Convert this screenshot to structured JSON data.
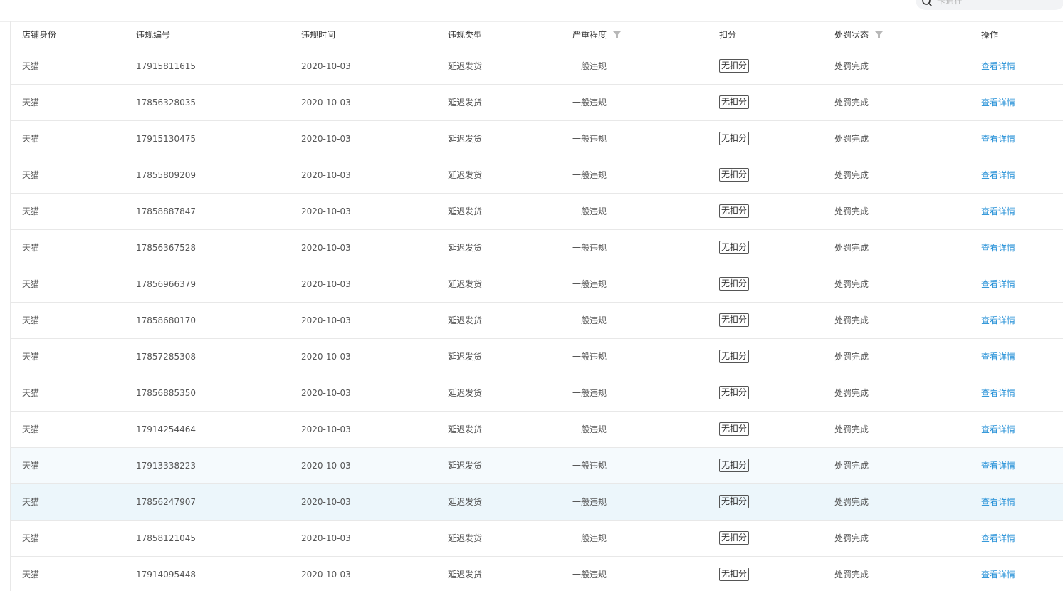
{
  "search": {
    "placeholder": "卡通在"
  },
  "table": {
    "columns": [
      {
        "label": "店铺身份",
        "filter": false
      },
      {
        "label": "违规编号",
        "filter": false
      },
      {
        "label": "违规时间",
        "filter": false
      },
      {
        "label": "违规类型",
        "filter": false
      },
      {
        "label": "严重程度",
        "filter": true
      },
      {
        "label": "扣分",
        "filter": false
      },
      {
        "label": "处罚状态",
        "filter": true
      },
      {
        "label": "操作",
        "filter": false
      }
    ],
    "rows": [
      {
        "shop": "天猫",
        "id": "17915811615",
        "date": "2020-10-03",
        "type": "延迟发货",
        "severity": "一般违规",
        "score": "无扣分",
        "status": "处罚完成",
        "action": "查看详情",
        "highlight": ""
      },
      {
        "shop": "天猫",
        "id": "17856328035",
        "date": "2020-10-03",
        "type": "延迟发货",
        "severity": "一般违规",
        "score": "无扣分",
        "status": "处罚完成",
        "action": "查看详情",
        "highlight": ""
      },
      {
        "shop": "天猫",
        "id": "17915130475",
        "date": "2020-10-03",
        "type": "延迟发货",
        "severity": "一般违规",
        "score": "无扣分",
        "status": "处罚完成",
        "action": "查看详情",
        "highlight": ""
      },
      {
        "shop": "天猫",
        "id": "17855809209",
        "date": "2020-10-03",
        "type": "延迟发货",
        "severity": "一般违规",
        "score": "无扣分",
        "status": "处罚完成",
        "action": "查看详情",
        "highlight": ""
      },
      {
        "shop": "天猫",
        "id": "17858887847",
        "date": "2020-10-03",
        "type": "延迟发货",
        "severity": "一般违规",
        "score": "无扣分",
        "status": "处罚完成",
        "action": "查看详情",
        "highlight": ""
      },
      {
        "shop": "天猫",
        "id": "17856367528",
        "date": "2020-10-03",
        "type": "延迟发货",
        "severity": "一般违规",
        "score": "无扣分",
        "status": "处罚完成",
        "action": "查看详情",
        "highlight": ""
      },
      {
        "shop": "天猫",
        "id": "17856966379",
        "date": "2020-10-03",
        "type": "延迟发货",
        "severity": "一般违规",
        "score": "无扣分",
        "status": "处罚完成",
        "action": "查看详情",
        "highlight": ""
      },
      {
        "shop": "天猫",
        "id": "17858680170",
        "date": "2020-10-03",
        "type": "延迟发货",
        "severity": "一般违规",
        "score": "无扣分",
        "status": "处罚完成",
        "action": "查看详情",
        "highlight": ""
      },
      {
        "shop": "天猫",
        "id": "17857285308",
        "date": "2020-10-03",
        "type": "延迟发货",
        "severity": "一般违规",
        "score": "无扣分",
        "status": "处罚完成",
        "action": "查看详情",
        "highlight": ""
      },
      {
        "shop": "天猫",
        "id": "17856885350",
        "date": "2020-10-03",
        "type": "延迟发货",
        "severity": "一般违规",
        "score": "无扣分",
        "status": "处罚完成",
        "action": "查看详情",
        "highlight": ""
      },
      {
        "shop": "天猫",
        "id": "17914254464",
        "date": "2020-10-03",
        "type": "延迟发货",
        "severity": "一般违规",
        "score": "无扣分",
        "status": "处罚完成",
        "action": "查看详情",
        "highlight": ""
      },
      {
        "shop": "天猫",
        "id": "17913338223",
        "date": "2020-10-03",
        "type": "延迟发货",
        "severity": "一般违规",
        "score": "无扣分",
        "status": "处罚完成",
        "action": "查看详情",
        "highlight": "light"
      },
      {
        "shop": "天猫",
        "id": "17856247907",
        "date": "2020-10-03",
        "type": "延迟发货",
        "severity": "一般违规",
        "score": "无扣分",
        "status": "处罚完成",
        "action": "查看详情",
        "highlight": "strong"
      },
      {
        "shop": "天猫",
        "id": "17858121045",
        "date": "2020-10-03",
        "type": "延迟发货",
        "severity": "一般违规",
        "score": "无扣分",
        "status": "处罚完成",
        "action": "查看详情",
        "highlight": ""
      },
      {
        "shop": "天猫",
        "id": "17914095448",
        "date": "2020-10-03",
        "type": "延迟发货",
        "severity": "一般违规",
        "score": "无扣分",
        "status": "处罚完成",
        "action": "查看详情",
        "highlight": ""
      }
    ]
  },
  "colors": {
    "link": "#1f8dd6",
    "border": "#e8e8e8",
    "row_highlight_light": "#f5fafd",
    "row_highlight_strong": "#ecf6fb",
    "filter_icon": "#b8b8b8"
  },
  "icons": {
    "search": "search-icon",
    "filter": "filter-icon"
  }
}
